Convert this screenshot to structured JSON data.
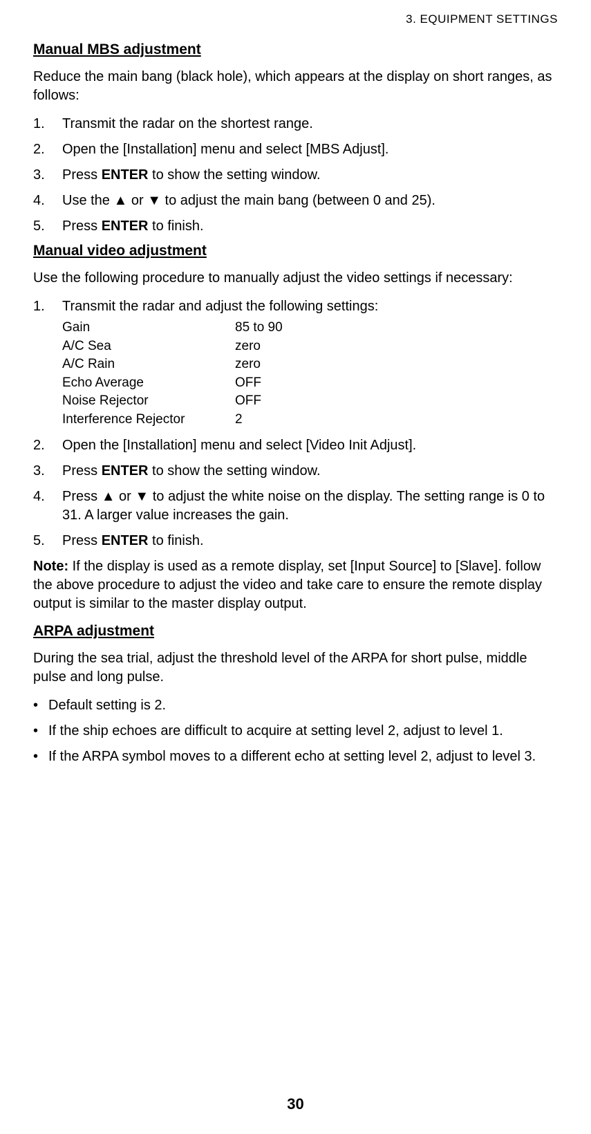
{
  "header": "3.  EQUIPMENT SETTINGS",
  "page_number": "30",
  "section_mbs": {
    "title": "Manual MBS adjustment",
    "intro": "Reduce the main bang (black hole), which appears at the display on short ranges, as follows:",
    "steps": {
      "1": "Transmit the radar on the shortest range.",
      "2": "Open the [Installation] menu and select [MBS Adjust].",
      "3_pre": "Press ",
      "3_bold": "ENTER",
      "3_post": " to show the setting window.",
      "4_pre": "Use the ",
      "4_up": "▲",
      "4_mid": " or ",
      "4_down": "▼",
      "4_post": " to adjust the main bang (between 0 and 25).",
      "5_pre": "Press ",
      "5_bold": "ENTER",
      "5_post": " to finish."
    }
  },
  "section_video": {
    "title": "Manual video adjustment",
    "intro": "Use the following procedure to manually adjust the video settings if necessary:",
    "step1": "Transmit the radar and adjust the following settings:",
    "settings": [
      {
        "label": "Gain",
        "value": "85 to 90"
      },
      {
        "label": "A/C Sea",
        "value": "zero"
      },
      {
        "label": "A/C Rain",
        "value": "zero"
      },
      {
        "label": "Echo Average",
        "value": "OFF"
      },
      {
        "label": "Noise Rejector",
        "value": "OFF"
      },
      {
        "label": "Interference Rejector",
        "value": "2"
      }
    ],
    "step2": "Open the [Installation] menu and select [Video Init Adjust].",
    "step3_pre": "Press ",
    "step3_bold": "ENTER",
    "step3_post": " to show the setting window.",
    "step4_pre": "Press ",
    "step4_up": "▲",
    "step4_mid": " or ",
    "step4_down": "▼",
    "step4_post": " to adjust the white noise on the display. The setting range is 0 to 31. A larger value increases the gain.",
    "step5_pre": "Press ",
    "step5_bold": "ENTER",
    "step5_post": " to finish.",
    "note_label": "Note:",
    "note_text": " If the display is used as a remote display, set [Input Source] to [Slave]. follow the above procedure to adjust the video and take care to ensure the remote display output is similar to the master display output."
  },
  "section_arpa": {
    "title": "ARPA adjustment",
    "intro": "During the sea trial, adjust the threshold level of the ARPA for short pulse, middle pulse and long pulse.",
    "bullets": [
      "Default setting is 2.",
      "If the ship echoes are difficult to acquire at setting level 2, adjust to level 1.",
      "If the ARPA symbol moves to a different echo at setting level 2, adjust to level 3."
    ]
  }
}
